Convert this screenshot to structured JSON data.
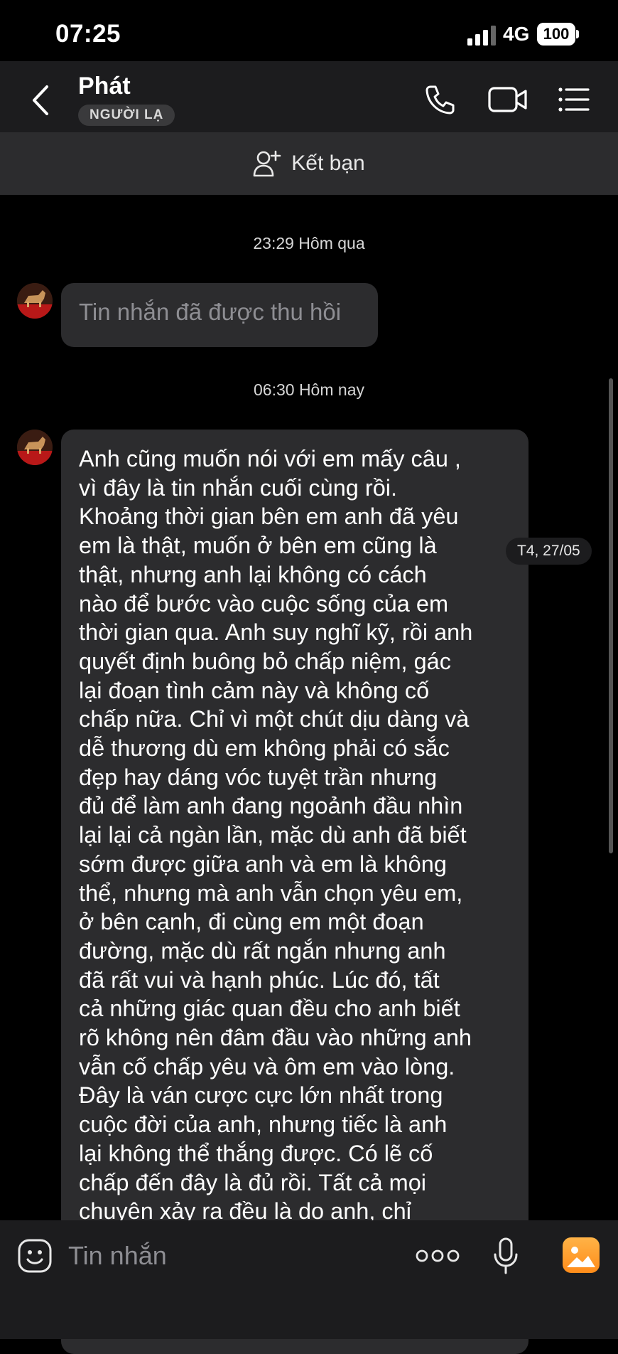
{
  "status_bar": {
    "time": "07:25",
    "network": "4G",
    "battery": "100"
  },
  "header": {
    "contact_name": "Phát",
    "badge": "NGƯỜI LẠ"
  },
  "add_friend": {
    "label": "Kết bạn"
  },
  "messages": [
    {
      "timestamp": "23:29 Hôm qua",
      "text": "Tin nhắn đã được thu hồi",
      "recalled": true
    },
    {
      "timestamp": "06:30 Hôm nay",
      "text": "Anh cũng muốn nói với em mấy câu ,\nvì đây là tin nhắn cuối cùng rồi.\nKhoảng thời gian bên em anh đã yêu\nem là thật, muốn ở bên em cũng là\nthật, nhưng anh lại không có cách\nnào để bước vào cuộc sống của em\nthời gian qua. Anh suy nghĩ kỹ, rồi anh\nquyết định buông bỏ chấp niệm, gác\nlại đoạn tình cảm này và không cố\nchấp nữa. Chỉ vì một chút dịu dàng và\ndễ thương dù em không phải có sắc\nđẹp hay dáng vóc tuyệt trần nhưng\nđủ để làm anh đang ngoảnh đầu nhìn\nlại lại cả ngàn lần, mặc dù anh đã biết\nsớm được giữa anh và em là không\nthể, nhưng mà anh vẫn chọn yêu em,\nở bên cạnh, đi cùng em một đoạn\nđường, mặc dù rất ngắn nhưng anh\nđã rất vui và hạnh phúc. Lúc đó, tất\ncả những giác quan đều cho anh biết\nrõ không nên đâm đầu vào những anh\nvẫn cố chấp yêu và ôm em vào lòng.\nĐây là ván cược cực lớn nhất trong\ncuộc đời của anh, nhưng tiếc là anh\nlại không thể thắng được. Có lẽ cố\nchấp đến đây là đủ rồi. Tất cả mọi\nchuyên xảy ra đều là do anh, chỉ",
      "recalled": false
    }
  ],
  "date_chip": "T4, 27/05",
  "input": {
    "placeholder": "Tin nhắn"
  },
  "colors": {
    "background": "#000000",
    "header": "#1c1c1e",
    "bubble": "#2c2c2e",
    "accent_image_button": "#ff9f2e"
  }
}
